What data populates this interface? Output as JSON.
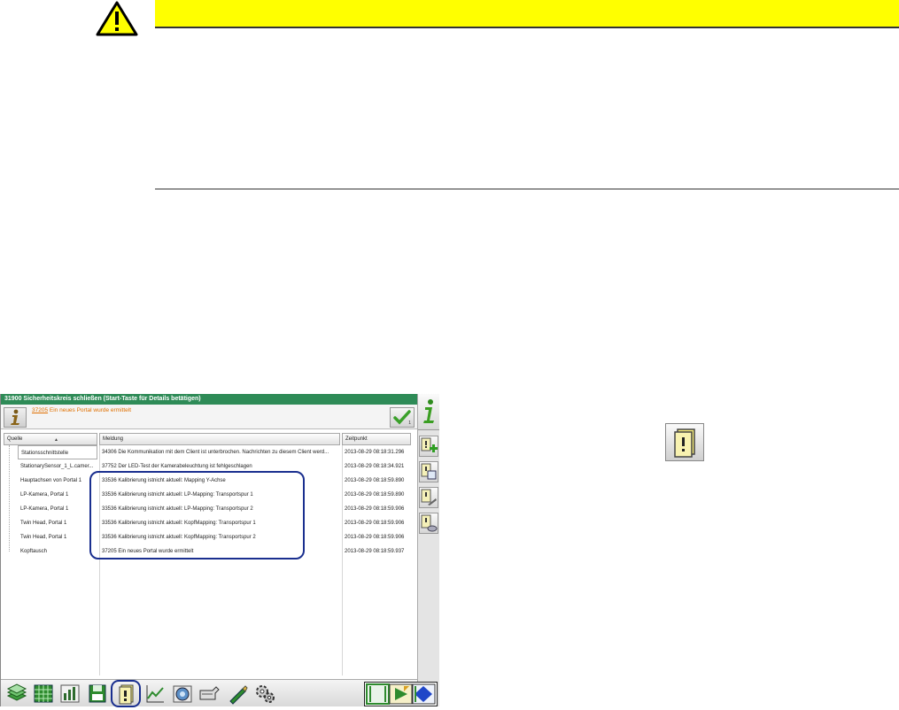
{
  "window": {
    "title": "31900 Sicherheitskreis schließen (Start-Taste für Details betätigen)",
    "message_number": "37205",
    "message_text": " Ein neues Portal wurde ermittelt",
    "check_sub": "1"
  },
  "table": {
    "headers": [
      "Quelle",
      "Meldung",
      "Zeitpunkt"
    ],
    "rows": [
      [
        "Stationsschnittstelle",
        "34306 Die Kommunikation mit dem Client ist unterbrochen. Nachrichten zu diesem Client werd...",
        "2013-08-29 08:18:31.296"
      ],
      [
        "StationarySensor_1_L.camer...",
        "37752 Der LED-Test der Kamerabeleuchtung ist fehlgeschlagen",
        "2013-08-29 08:18:34.921"
      ],
      [
        "Hauptachsen von Portal 1",
        "33536 Kalibrierung istnicht aktuell: Mapping Y-Achse",
        "2013-08-29 08:18:59.890"
      ],
      [
        "LP-Kamera, Portal 1",
        "33536 Kalibrierung istnicht aktuell: LP-Mapping: Transportspur 1",
        "2013-08-29 08:18:59.890"
      ],
      [
        "LP-Kamera, Portal 1",
        "33536 Kalibrierung istnicht aktuell: LP-Mapping: Transportspur 2",
        "2013-08-29 08:18:59.906"
      ],
      [
        "Twin Head, Portal 1",
        "33536 Kalibrierung istnicht aktuell: KopfMapping: Transportspur 1",
        "2013-08-29 08:18:59.906"
      ],
      [
        "Twin Head, Portal 1",
        "33536 Kalibrierung istnicht aktuell: KopfMapping: Transportspur 2",
        "2013-08-29 08:18:59.906"
      ],
      [
        "Kopftausch",
        "37205 Ein neues Portal wurde ermittelt",
        "2013-08-29 08:18:59.937"
      ]
    ]
  },
  "icons": {
    "warning": "warning-triangle-icon",
    "info": "info-icon",
    "check": "checkmark-icon"
  },
  "colors": {
    "warning_bar": "#ffff00",
    "title_bar": "#2e8b57",
    "message_text": "#e07000",
    "highlight": "#1a2f8f"
  }
}
